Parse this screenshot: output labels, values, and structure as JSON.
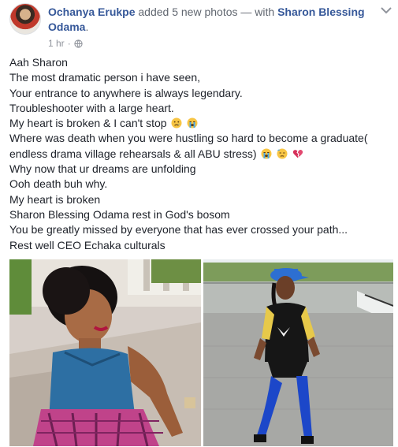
{
  "post": {
    "author": "Ochanya Erukpe",
    "action": "added 5 new photos",
    "with_text": "— with",
    "tagged": "Sharon Blessing Odama",
    "trailing": ".",
    "timestamp": "1 hr",
    "separator": "·",
    "privacy_icon": "globe-icon",
    "menu_icon": "chevron-down-icon"
  },
  "message": {
    "lines": [
      "Aah Sharon",
      "The most dramatic person i have seen,",
      "Your entrance to anywhere is always legendary.",
      "Troubleshooter with a large heart.",
      "My heart is broken & I can't stop",
      "Where was death when you were hustling so hard to become a graduate(",
      "endless drama village rehearsals & all ABU stress)",
      "Why now that ur dreams are unfolding",
      "Ooh death buh why.",
      "My heart is broken",
      "Sharon Blessing Odama rest in God's bosom",
      "You be greatly missed by everyone that has ever crossed your path...",
      "Rest well CEO Echaka culturals"
    ],
    "emojis_line5": [
      "crying-face-emoji",
      "loudly-crying-face-emoji"
    ],
    "emojis_line7": [
      "loudly-crying-face-emoji",
      "downcast-face-emoji",
      "broken-heart-emoji"
    ]
  },
  "photos": {
    "items": [
      {
        "description_icon": "photo-woman-blue-top"
      },
      {
        "description_icon": "photo-woman-blue-cap"
      }
    ]
  },
  "colors": {
    "link": "#365899",
    "meta": "#90949c",
    "text": "#1d2129"
  }
}
